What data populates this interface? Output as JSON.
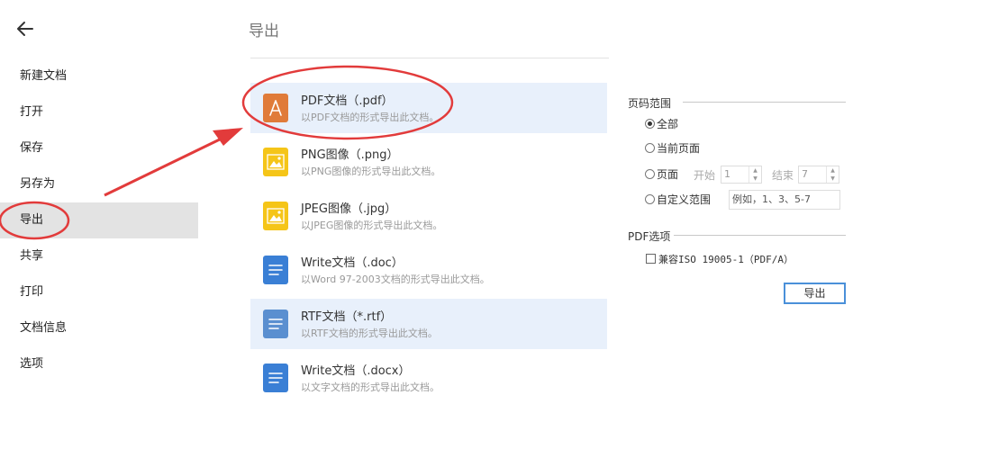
{
  "sidebar": {
    "items": [
      {
        "label": "新建文档"
      },
      {
        "label": "打开"
      },
      {
        "label": "保存"
      },
      {
        "label": "另存为"
      },
      {
        "label": "导出"
      },
      {
        "label": "共享"
      },
      {
        "label": "打印"
      },
      {
        "label": "文档信息"
      },
      {
        "label": "选项"
      }
    ],
    "active_index": 4
  },
  "main": {
    "title": "导出",
    "formats": [
      {
        "name": "PDF文档（.pdf）",
        "desc": "以PDF文档的形式导出此文档。",
        "icon": "pdf-icon",
        "color": "#e07b39"
      },
      {
        "name": "PNG图像（.png）",
        "desc": "以PNG图像的形式导出此文档。",
        "icon": "image-icon",
        "color": "#f5c518"
      },
      {
        "name": "JPEG图像（.jpg）",
        "desc": "以JPEG图像的形式导出此文档。",
        "icon": "image-icon",
        "color": "#f5c518"
      },
      {
        "name": "Write文档（.doc）",
        "desc": "以Word 97-2003文档的形式导出此文档。",
        "icon": "document-icon",
        "color": "#3a7fd5"
      },
      {
        "name": "RTF文档（*.rtf）",
        "desc": "以RTF文档的形式导出此文档。",
        "icon": "document-icon",
        "color": "#5a8fd0"
      },
      {
        "name": "Write文档（.docx）",
        "desc": "以文字文档的形式导出此文档。",
        "icon": "document-icon",
        "color": "#3a7fd5"
      }
    ],
    "selected_index": 0
  },
  "panel": {
    "page_range_label": "页码范围",
    "options": {
      "all": "全部",
      "current": "当前页面",
      "pages": "页面",
      "custom": "自定义范围"
    },
    "selected_option": "all",
    "start_label": "开始",
    "start_value": "1",
    "end_label": "结束",
    "end_value": "7",
    "custom_example": "例如，1、3、5-7",
    "pdf_options_label": "PDF选项",
    "pdfa_label": "兼容ISO 19005-1（PDF/A）",
    "pdfa_checked": false,
    "export_button": "导出"
  },
  "colors": {
    "accent": "#4a90d9",
    "selected_row": "#e8f0fb",
    "sidebar_active": "#e3e3e3",
    "annotation": "#e23b3b"
  }
}
